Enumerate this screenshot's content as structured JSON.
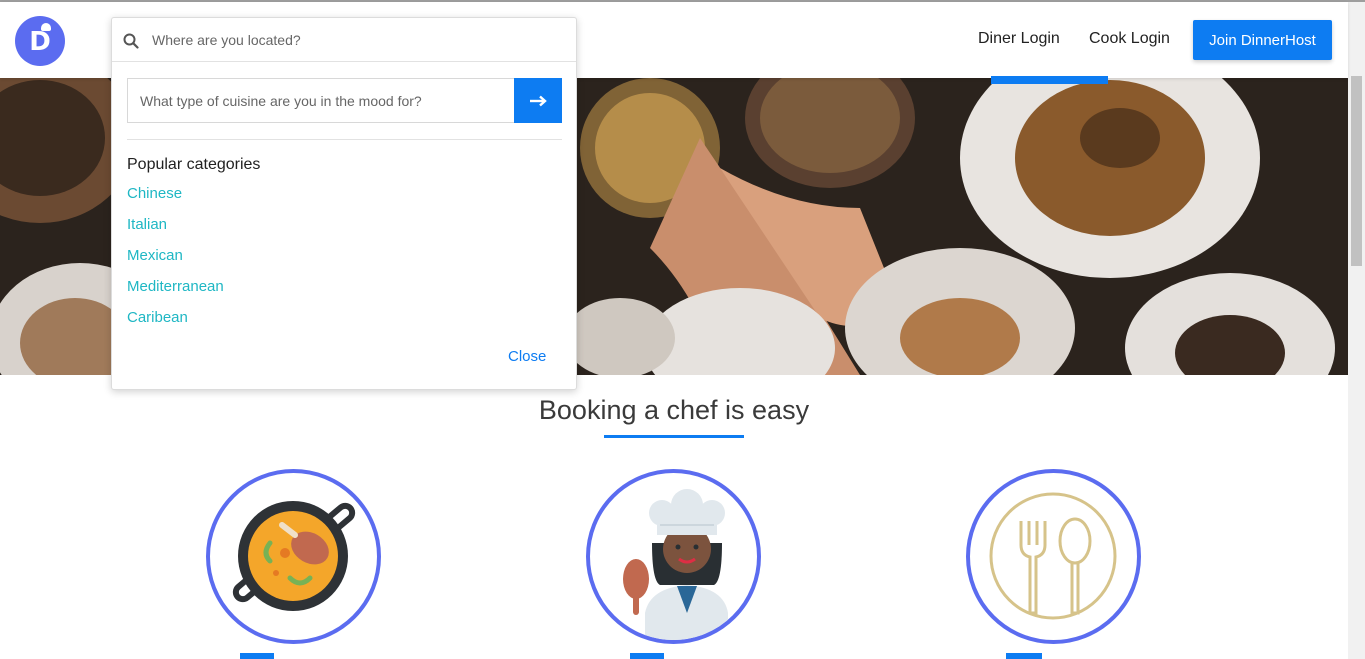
{
  "header": {
    "logo_letter": "D",
    "nav": {
      "diner_login": "Diner Login",
      "cook_login": "Cook Login",
      "join": "Join DinnerHost"
    }
  },
  "search": {
    "location_placeholder": "Where are you located?",
    "cuisine_placeholder": "What type of cuisine are you in the mood for?",
    "categories_title": "Popular categories",
    "categories": [
      "Chinese",
      "Italian",
      "Mexican",
      "Mediterranean",
      "Caribean"
    ],
    "close_label": "Close"
  },
  "section": {
    "title": "Booking a chef is easy",
    "steps": [
      {
        "icon": "paella-pan-icon"
      },
      {
        "icon": "chef-icon"
      },
      {
        "icon": "fork-spoon-icon"
      }
    ]
  },
  "colors": {
    "accent": "#0d7cf2",
    "brand": "#5b6cf0",
    "category_link": "#1fb7c4"
  }
}
